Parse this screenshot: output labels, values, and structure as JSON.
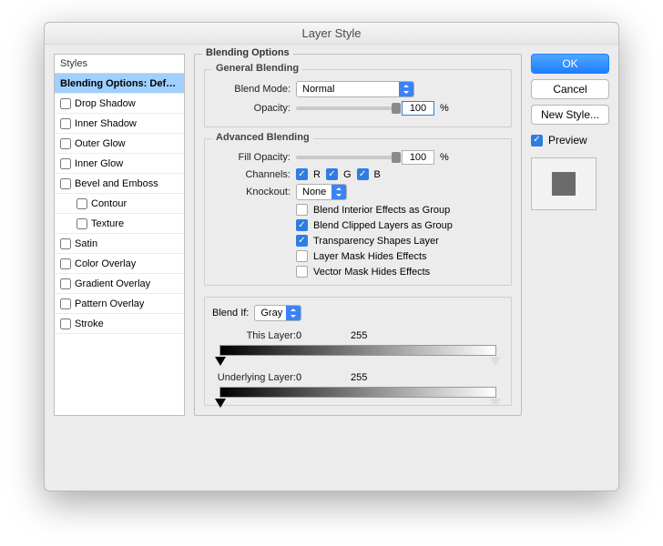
{
  "window": {
    "title": "Layer Style"
  },
  "styles": {
    "header": "Styles",
    "items": [
      {
        "label": "Blending Options: Default",
        "hasCheckbox": false,
        "checked": false,
        "selected": true
      },
      {
        "label": "Drop Shadow",
        "hasCheckbox": true,
        "checked": false
      },
      {
        "label": "Inner Shadow",
        "hasCheckbox": true,
        "checked": false
      },
      {
        "label": "Outer Glow",
        "hasCheckbox": true,
        "checked": false
      },
      {
        "label": "Inner Glow",
        "hasCheckbox": true,
        "checked": false
      },
      {
        "label": "Bevel and Emboss",
        "hasCheckbox": true,
        "checked": false
      },
      {
        "label": "Contour",
        "hasCheckbox": true,
        "checked": false,
        "indent": true
      },
      {
        "label": "Texture",
        "hasCheckbox": true,
        "checked": false,
        "indent": true
      },
      {
        "label": "Satin",
        "hasCheckbox": true,
        "checked": false
      },
      {
        "label": "Color Overlay",
        "hasCheckbox": true,
        "checked": false
      },
      {
        "label": "Gradient Overlay",
        "hasCheckbox": true,
        "checked": false
      },
      {
        "label": "Pattern Overlay",
        "hasCheckbox": true,
        "checked": false
      },
      {
        "label": "Stroke",
        "hasCheckbox": true,
        "checked": false
      }
    ]
  },
  "section": {
    "title": "Blending Options",
    "general": {
      "title": "General Blending",
      "blendModeLabel": "Blend Mode:",
      "blendModeValue": "Normal",
      "opacityLabel": "Opacity:",
      "opacityValue": "100",
      "opacityUnit": "%"
    },
    "advanced": {
      "title": "Advanced Blending",
      "fillOpacityLabel": "Fill Opacity:",
      "fillOpacityValue": "100",
      "fillOpacityUnit": "%",
      "channelsLabel": "Channels:",
      "channelR": "R",
      "channelG": "G",
      "channelB": "B",
      "knockoutLabel": "Knockout:",
      "knockoutValue": "None",
      "opts": [
        {
          "label": "Blend Interior Effects as Group",
          "checked": false
        },
        {
          "label": "Blend Clipped Layers as Group",
          "checked": true
        },
        {
          "label": "Transparency Shapes Layer",
          "checked": true
        },
        {
          "label": "Layer Mask Hides Effects",
          "checked": false
        },
        {
          "label": "Vector Mask Hides Effects",
          "checked": false
        }
      ]
    },
    "blendIf": {
      "label": "Blend If:",
      "value": "Gray",
      "thisLayerLabel": "This Layer:",
      "thisLow": "0",
      "thisHigh": "255",
      "underLabel": "Underlying Layer:",
      "underLow": "0",
      "underHigh": "255"
    }
  },
  "buttons": {
    "ok": "OK",
    "cancel": "Cancel",
    "newStyle": "New Style...",
    "preview": "Preview"
  }
}
